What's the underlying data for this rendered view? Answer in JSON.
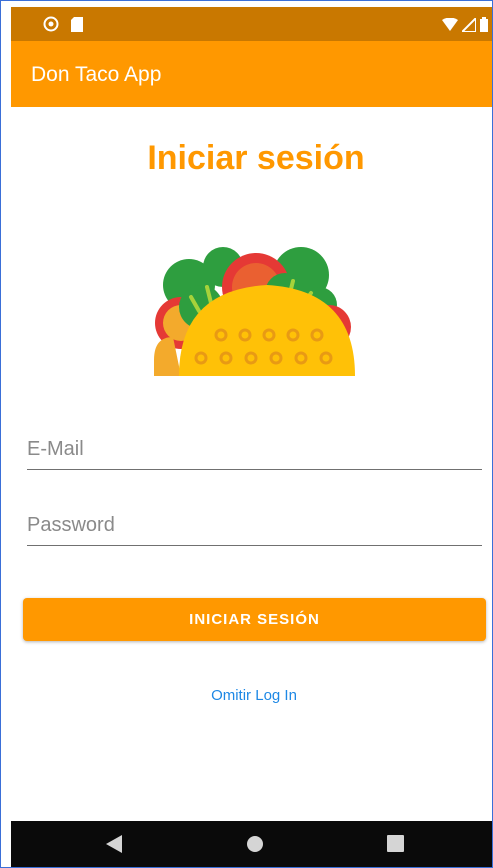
{
  "status_bar": {
    "icons": [
      "sync-icon",
      "sd-card-icon",
      "wifi-icon",
      "signal-icon",
      "battery-icon"
    ]
  },
  "app_bar": {
    "title": "Don Taco App"
  },
  "login": {
    "title": "Iniciar sesión",
    "email_placeholder": "E-Mail",
    "password_placeholder": "Password",
    "login_button": "INICIAR SESIÓN",
    "skip_link": "Omitir Log In"
  },
  "navigation": {
    "icons": [
      "back-icon",
      "home-icon",
      "recents-icon"
    ]
  },
  "colors": {
    "primary": "#ff9800",
    "status_bar": "#c97800",
    "link": "#1e88e5",
    "nav_bar": "#0a0a0a"
  }
}
